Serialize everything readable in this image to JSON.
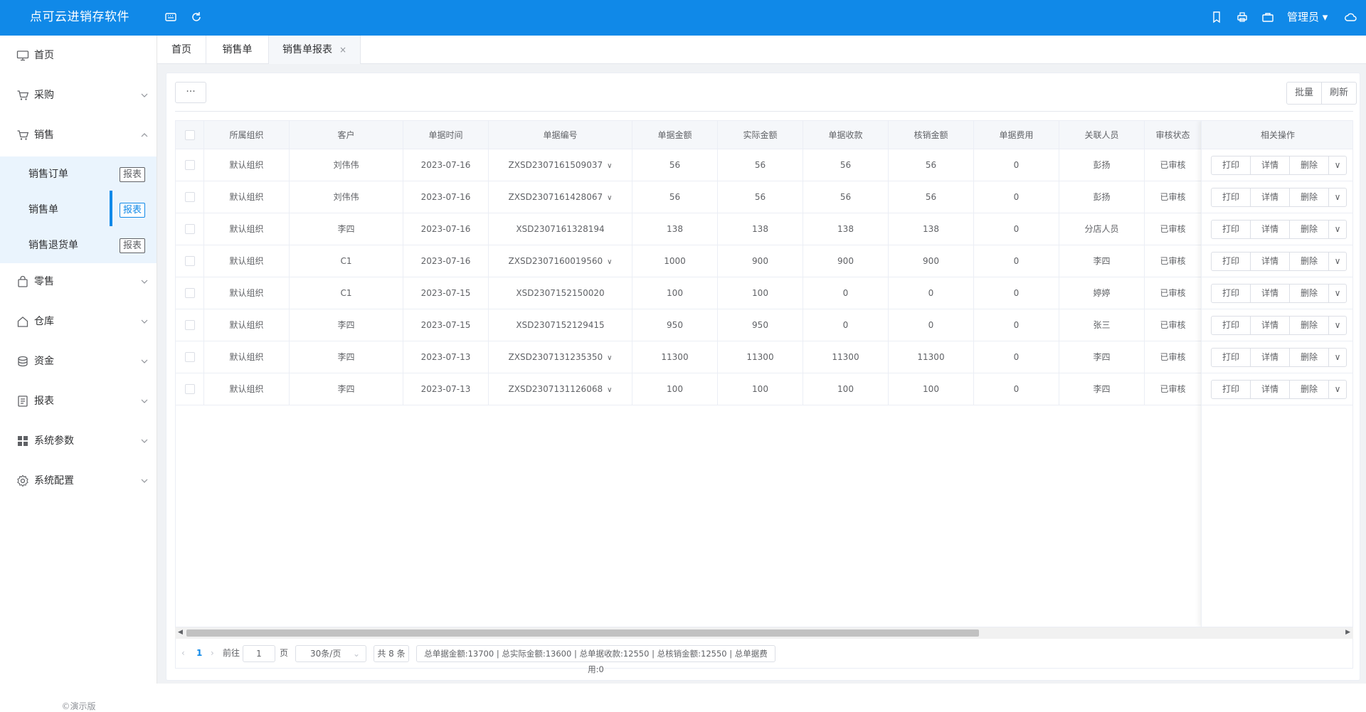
{
  "app": {
    "title": "点可云进销存软件",
    "user": "管理员"
  },
  "sidebar": {
    "items": [
      {
        "label": "首页",
        "icon": "monitor-icon"
      },
      {
        "label": "采购",
        "icon": "cart-icon"
      },
      {
        "label": "销售",
        "icon": "cart-icon",
        "expanded": true
      },
      {
        "label": "零售",
        "icon": "bag-icon"
      },
      {
        "label": "仓库",
        "icon": "home-icon"
      },
      {
        "label": "资金",
        "icon": "coins-icon"
      },
      {
        "label": "报表",
        "icon": "document-icon"
      },
      {
        "label": "系统参数",
        "icon": "grid-icon"
      },
      {
        "label": "系统配置",
        "icon": "gear-icon"
      }
    ],
    "sub_items": [
      {
        "label": "销售订单",
        "tag": "报表"
      },
      {
        "label": "销售单",
        "tag": "报表",
        "active": true
      },
      {
        "label": "销售退货单",
        "tag": "报表"
      }
    ],
    "footer": "©演示版"
  },
  "tabs": [
    {
      "label": "首页"
    },
    {
      "label": "销售单"
    },
    {
      "label": "销售单报表",
      "active": true,
      "close": "×"
    }
  ],
  "toolbar": {
    "more_label": "···",
    "batch_label": "批量",
    "refresh_label": "刷新"
  },
  "table": {
    "columns": [
      "所属组织",
      "客户",
      "单据时间",
      "单据编号",
      "单据金额",
      "实际金额",
      "单据收款",
      "核销金额",
      "单据费用",
      "关联人员",
      "审核状态"
    ],
    "actions_header": "相关操作",
    "action_labels": {
      "print": "打印",
      "detail": "详情",
      "delete": "删除"
    },
    "rows": [
      {
        "org": "默认组织",
        "customer": "刘伟伟",
        "date": "2023-07-16",
        "number": "ZXSD2307161509037",
        "has_dropdown": true,
        "amount": "56",
        "actual": "56",
        "received": "56",
        "writeoff": "56",
        "fee": "0",
        "person": "彭扬",
        "status": "已审核"
      },
      {
        "org": "默认组织",
        "customer": "刘伟伟",
        "date": "2023-07-16",
        "number": "ZXSD2307161428067",
        "has_dropdown": true,
        "amount": "56",
        "actual": "56",
        "received": "56",
        "writeoff": "56",
        "fee": "0",
        "person": "彭扬",
        "status": "已审核"
      },
      {
        "org": "默认组织",
        "customer": "李四",
        "date": "2023-07-16",
        "number": "XSD2307161328194",
        "has_dropdown": false,
        "amount": "138",
        "actual": "138",
        "received": "138",
        "writeoff": "138",
        "fee": "0",
        "person": "分店人员",
        "status": "已审核"
      },
      {
        "org": "默认组织",
        "customer": "C1",
        "date": "2023-07-16",
        "number": "ZXSD2307160019560",
        "has_dropdown": true,
        "amount": "1000",
        "actual": "900",
        "received": "900",
        "writeoff": "900",
        "fee": "0",
        "person": "李四",
        "status": "已审核"
      },
      {
        "org": "默认组织",
        "customer": "C1",
        "date": "2023-07-15",
        "number": "XSD2307152150020",
        "has_dropdown": false,
        "amount": "100",
        "actual": "100",
        "received": "0",
        "writeoff": "0",
        "fee": "0",
        "person": "婷婷",
        "status": "已审核"
      },
      {
        "org": "默认组织",
        "customer": "李四",
        "date": "2023-07-15",
        "number": "XSD2307152129415",
        "has_dropdown": false,
        "amount": "950",
        "actual": "950",
        "received": "0",
        "writeoff": "0",
        "fee": "0",
        "person": "张三",
        "status": "已审核"
      },
      {
        "org": "默认组织",
        "customer": "李四",
        "date": "2023-07-13",
        "number": "ZXSD2307131235350",
        "has_dropdown": true,
        "amount": "11300",
        "actual": "11300",
        "received": "11300",
        "writeoff": "11300",
        "fee": "0",
        "person": "李四",
        "status": "已审核"
      },
      {
        "org": "默认组织",
        "customer": "李四",
        "date": "2023-07-13",
        "number": "ZXSD2307131126068",
        "has_dropdown": true,
        "amount": "100",
        "actual": "100",
        "received": "100",
        "writeoff": "100",
        "fee": "0",
        "person": "李四",
        "status": "已审核"
      }
    ]
  },
  "pagination": {
    "current": "1",
    "goto_prefix": "前往",
    "goto_value": "1",
    "goto_suffix": "页",
    "page_size": "30条/页",
    "total": "共 8 条",
    "summary": "总单据金额:13700 | 总实际金额:13600 | 总单据收款:12550 | 总核销金额:12550 | 总单据费用:0"
  },
  "colors": {
    "primary": "#1089e8",
    "sub_bg": "#eaf4fd",
    "page_bg": "#f0f2f5"
  }
}
